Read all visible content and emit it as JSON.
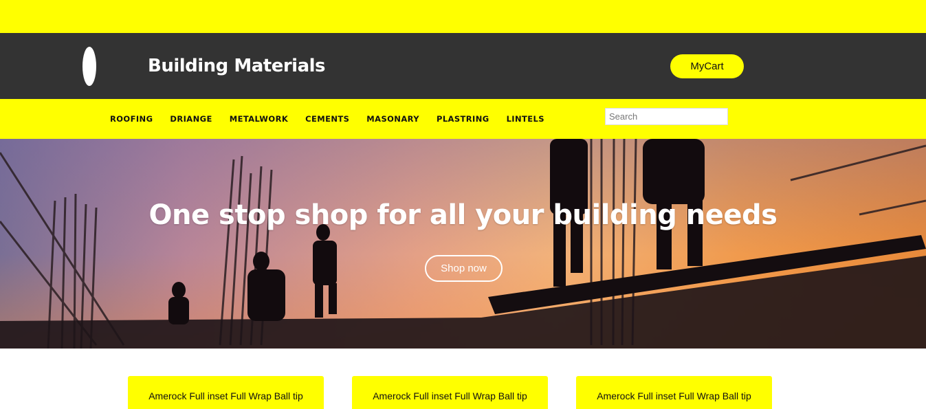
{
  "header": {
    "brand": "Building Materials",
    "cart_label": "MyCart"
  },
  "nav": {
    "items": [
      {
        "label": "ROOFING"
      },
      {
        "label": "DRIANGE"
      },
      {
        "label": "METALWORK"
      },
      {
        "label": "CEMENTS"
      },
      {
        "label": "MASONARY"
      },
      {
        "label": "PLASTRING"
      },
      {
        "label": "LINTELS"
      }
    ],
    "search_placeholder": "Search"
  },
  "hero": {
    "title": "One stop shop for all your building needs",
    "cta_label": "Shop now"
  },
  "products": [
    {
      "title": "Amerock Full inset Full Wrap Ball tip"
    },
    {
      "title": "Amerock Full inset Full Wrap Ball tip"
    },
    {
      "title": "Amerock Full inset Full Wrap Ball tip"
    }
  ],
  "colors": {
    "accent": "#ffff00",
    "header_bg": "#333333"
  }
}
